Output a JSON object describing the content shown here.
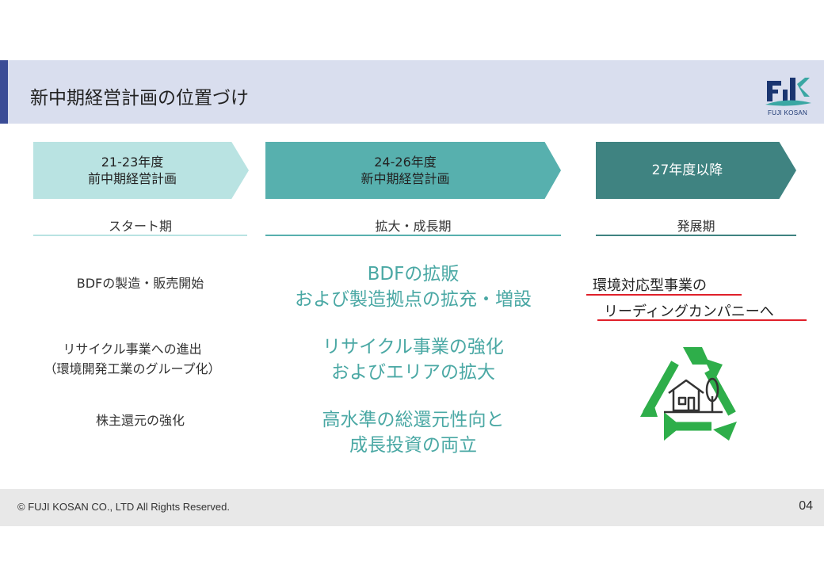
{
  "header": {
    "title": "新中期経営計画の位置づけ",
    "logo_text": "FUJI KOSAN"
  },
  "phases": [
    {
      "period": "21-23年度",
      "plan": "前中期経営計画",
      "stage": "スタート期",
      "color": "#b9e3e2"
    },
    {
      "period": "24-26年度",
      "plan": "新中期経営計画",
      "stage": "拡大・成長期",
      "color": "#57b0ae"
    },
    {
      "period": "27年度以降",
      "plan": "",
      "stage": "発展期",
      "color": "#3f8381"
    }
  ],
  "left_items": [
    {
      "line1": "BDFの製造・販売開始",
      "line2": ""
    },
    {
      "line1": "リサイクル事業への進出",
      "line2": "（環境開発工業のグループ化）"
    },
    {
      "line1": "株主還元の強化",
      "line2": ""
    }
  ],
  "middle_items": [
    {
      "line1": "BDFの拡販",
      "line2": "および製造拠点の拡充・増設"
    },
    {
      "line1": "リサイクル事業の強化",
      "line2": "およびエリアの拡大"
    },
    {
      "line1": "高水準の総還元性向と",
      "line2": "成長投資の両立"
    }
  ],
  "vision": {
    "line1": "環境対応型事業の",
    "line2": "リーディングカンパニーへ",
    "icon": "recycle-house-icon"
  },
  "footer": {
    "copyright": "© FUJI KOSAN CO., LTD All Rights Reserved.",
    "page": "04"
  },
  "colors": {
    "header_bg": "#d9deee",
    "header_accent": "#3a4c96",
    "accent_teal": "#4aa8a4",
    "recycle_green": "#2eae4a",
    "underline_red": "#e0202a"
  }
}
